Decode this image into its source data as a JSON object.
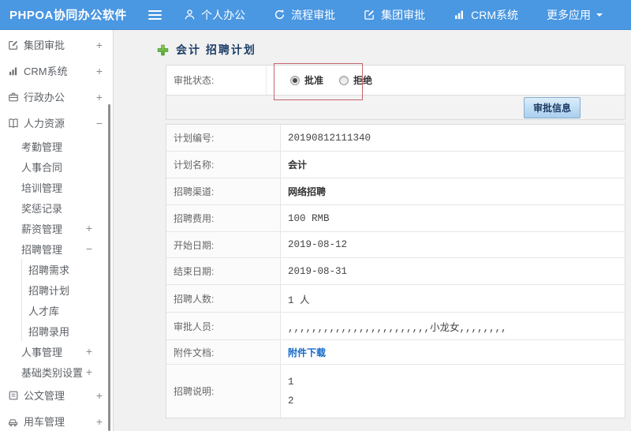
{
  "header": {
    "logo": "PHPOA协同办公软件",
    "nav": [
      {
        "key": "personal-office",
        "label": "个人办公",
        "icon": "user-icon"
      },
      {
        "key": "process-approval",
        "label": "流程审批",
        "icon": "process-icon"
      },
      {
        "key": "group-approval",
        "label": "集团审批",
        "icon": "edit-square-icon"
      },
      {
        "key": "crm-system",
        "label": "CRM系统",
        "icon": "bar-chart-icon"
      },
      {
        "key": "more-apps",
        "label": "更多应用",
        "caret": true
      }
    ]
  },
  "sidebar": {
    "items": [
      {
        "key": "group-approval",
        "label": "集团审批",
        "icon": "edit-square-icon",
        "expand": "+",
        "level": 0
      },
      {
        "key": "crm-system",
        "label": "CRM系统",
        "icon": "bar-chart-icon",
        "expand": "+",
        "level": 0
      },
      {
        "key": "admin-office",
        "label": "行政办公",
        "icon": "briefcase-icon",
        "expand": "+",
        "level": 0
      },
      {
        "key": "human-resources",
        "label": "人力资源",
        "icon": "book-icon",
        "expand": "−",
        "level": 0
      },
      {
        "key": "attendance-mgmt",
        "label": "考勤管理",
        "level": 1
      },
      {
        "key": "personnel-contract",
        "label": "人事合同",
        "level": 1
      },
      {
        "key": "training-mgmt",
        "label": "培训管理",
        "level": 1
      },
      {
        "key": "reward-punishment",
        "label": "奖惩记录",
        "level": 1
      },
      {
        "key": "salary-mgmt",
        "label": "薪资管理",
        "expand": "+",
        "level": 1
      },
      {
        "key": "recruitment-mgmt",
        "label": "招聘管理",
        "expand": "−",
        "level": 1
      },
      {
        "key": "recruitment-demand",
        "label": "招聘需求",
        "level": 2
      },
      {
        "key": "recruitment-plan",
        "label": "招聘计划",
        "level": 2
      },
      {
        "key": "talent-pool",
        "label": "人才库",
        "level": 2
      },
      {
        "key": "recruitment-hire",
        "label": "招聘录用",
        "level": 2
      },
      {
        "key": "personnel-mgmt",
        "label": "人事管理",
        "expand": "+",
        "level": 1
      },
      {
        "key": "basic-category-settings",
        "label": "基础类别设置",
        "expand": "+",
        "level": 1
      },
      {
        "key": "document-mgmt",
        "label": "公文管理",
        "icon": "doc-icon",
        "expand": "+",
        "level": 0
      },
      {
        "key": "vehicle-mgmt",
        "label": "用车管理",
        "icon": "car-icon",
        "expand": "+",
        "level": 0
      }
    ]
  },
  "main": {
    "breadcrumb": "会计 招聘计划",
    "approval": {
      "label": "审批状态:",
      "options": [
        {
          "label": "批准",
          "selected": true
        },
        {
          "label": "拒绝",
          "selected": false
        }
      ],
      "button_label": "审批信息"
    },
    "fields": [
      {
        "key": "plan-number",
        "label": "计划编号:",
        "value": "20190812111340",
        "mono": true
      },
      {
        "key": "plan-name",
        "label": "计划名称:",
        "value": "会计"
      },
      {
        "key": "recruit-channel",
        "label": "招聘渠道:",
        "value": "网络招聘"
      },
      {
        "key": "recruit-cost",
        "label": "招聘费用:",
        "value": "100 RMB",
        "mono": true
      },
      {
        "key": "start-date",
        "label": "开始日期:",
        "value": "2019-08-12",
        "mono": true
      },
      {
        "key": "end-date",
        "label": "结束日期:",
        "value": "2019-08-31",
        "mono": true
      },
      {
        "key": "recruit-count",
        "label": "招聘人数:",
        "value": "1 人",
        "mono": true
      },
      {
        "key": "approvers",
        "label": "审批人员:",
        "value": ",,,,,,,,,,,,,,,,,,,,,,,,小龙女,,,,,,,,",
        "mono": true
      },
      {
        "key": "attachment",
        "label": "附件文档:",
        "value": "附件下载",
        "type": "link"
      },
      {
        "key": "recruit-description",
        "label": "招聘说明:",
        "lines": [
          "1",
          "2"
        ],
        "type": "multiline"
      }
    ]
  }
}
